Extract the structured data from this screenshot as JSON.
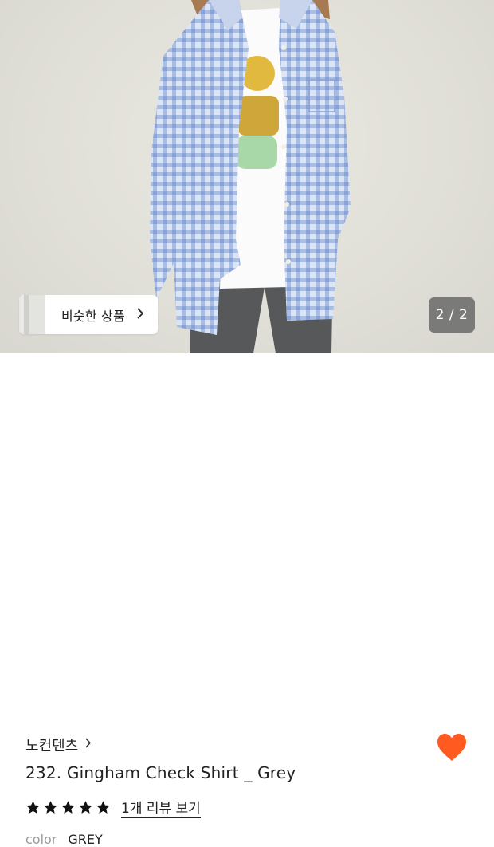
{
  "gallery": {
    "similar_products_label": "비슷한 상품",
    "page_counter": "2 / 2"
  },
  "product": {
    "brand": "노컨텐츠",
    "title": "232. Gingham Check Shirt _ Grey",
    "rating_stars": 5,
    "review_link": "1개 리뷰 보기",
    "option_label": "color",
    "option_value": "GREY",
    "liked": true
  },
  "colors": {
    "accent_heart": "#ff5a1f",
    "star": "#111111"
  },
  "icons": {
    "similar": "chevron-right-icon",
    "brand": "chevron-right-icon",
    "wishlist": "heart-icon",
    "rating": "star-icon"
  }
}
